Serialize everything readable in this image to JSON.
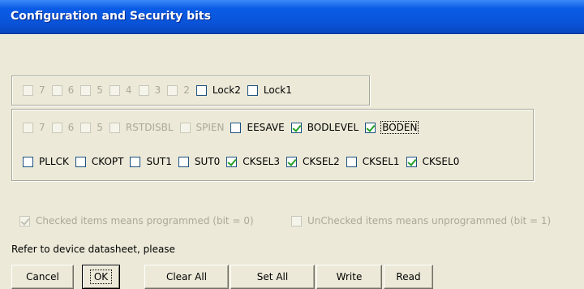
{
  "window": {
    "title": "Configuration and Security bits"
  },
  "lock_bits": [
    {
      "label": "7",
      "checked": false,
      "disabled": true
    },
    {
      "label": "6",
      "checked": false,
      "disabled": true
    },
    {
      "label": "5",
      "checked": false,
      "disabled": true
    },
    {
      "label": "4",
      "checked": false,
      "disabled": true
    },
    {
      "label": "3",
      "checked": false,
      "disabled": true
    },
    {
      "label": "2",
      "checked": false,
      "disabled": true
    },
    {
      "label": "Lock2",
      "checked": false,
      "disabled": false
    },
    {
      "label": "Lock1",
      "checked": false,
      "disabled": false
    }
  ],
  "fuse_high": [
    {
      "label": "7",
      "checked": false,
      "disabled": true
    },
    {
      "label": "6",
      "checked": false,
      "disabled": true
    },
    {
      "label": "5",
      "checked": false,
      "disabled": true
    },
    {
      "label": "RSTDISBL",
      "checked": false,
      "disabled": true
    },
    {
      "label": "SPIEN",
      "checked": false,
      "disabled": true
    },
    {
      "label": "EESAVE",
      "checked": false,
      "disabled": false
    },
    {
      "label": "BODLEVEL",
      "checked": true,
      "disabled": false
    },
    {
      "label": "BODEN",
      "checked": true,
      "disabled": false,
      "focused": true
    }
  ],
  "fuse_low": [
    {
      "label": "PLLCK",
      "checked": false,
      "disabled": false
    },
    {
      "label": "CKOPT",
      "checked": false,
      "disabled": false
    },
    {
      "label": "SUT1",
      "checked": false,
      "disabled": false
    },
    {
      "label": "SUT0",
      "checked": false,
      "disabled": false
    },
    {
      "label": "CKSEL3",
      "checked": true,
      "disabled": false
    },
    {
      "label": "CKSEL2",
      "checked": true,
      "disabled": false
    },
    {
      "label": "CKSEL1",
      "checked": false,
      "disabled": false
    },
    {
      "label": "CKSEL0",
      "checked": true,
      "disabled": false
    }
  ],
  "legend": {
    "checked_text": "Checked items means programmed (bit = 0)",
    "unchecked_text": "UnChecked items means unprogrammed (bit = 1)"
  },
  "note": "Refer to device datasheet, please",
  "buttons": {
    "cancel": "Cancel",
    "ok": "OK",
    "clear_all": "Clear All",
    "set_all": "Set All",
    "write": "Write",
    "read": "Read"
  },
  "colors": {
    "title_bar": "#0a53d8",
    "face": "#ece9d8",
    "check": "#21a121"
  }
}
